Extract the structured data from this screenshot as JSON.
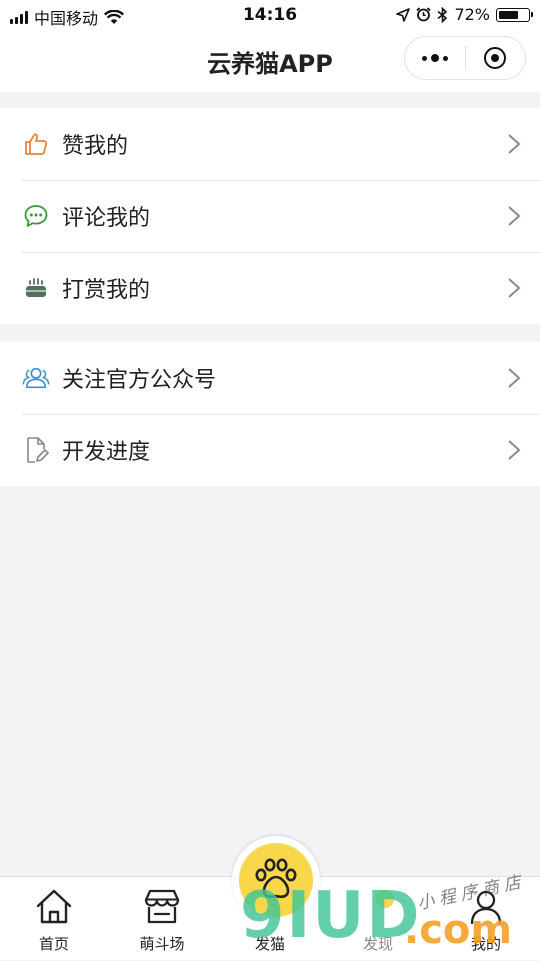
{
  "status_bar": {
    "carrier": "中国移动",
    "time": "14:16",
    "battery_percent": "72%",
    "battery_level": 0.72
  },
  "nav": {
    "title": "云养猫APP"
  },
  "menu_groups": [
    {
      "items": [
        {
          "label": "赞我的",
          "icon": "thumbs-up-icon",
          "color": "#e8843a"
        },
        {
          "label": "评论我的",
          "icon": "comment-icon",
          "color": "#3a9a3a"
        },
        {
          "label": "打赏我的",
          "icon": "gift-icon",
          "color": "#4f6f5f"
        }
      ]
    },
    {
      "items": [
        {
          "label": "关注官方公众号",
          "icon": "users-icon",
          "color": "#3d8fd8"
        },
        {
          "label": "开发进度",
          "icon": "document-edit-icon",
          "color": "#888888"
        }
      ]
    }
  ],
  "tab_bar": {
    "tabs": [
      {
        "label": "首页",
        "icon": "home-icon"
      },
      {
        "label": "萌斗场",
        "icon": "store-icon"
      },
      {
        "label": "发猫",
        "icon": "paw-icon"
      },
      {
        "label": "发现",
        "icon": "discover-icon"
      },
      {
        "label": "我的",
        "icon": "user-icon"
      }
    ],
    "center_color": "#f8d84a"
  },
  "watermark": {
    "logo": "9IUD",
    "domain": ".com",
    "script": "小程序商店"
  }
}
